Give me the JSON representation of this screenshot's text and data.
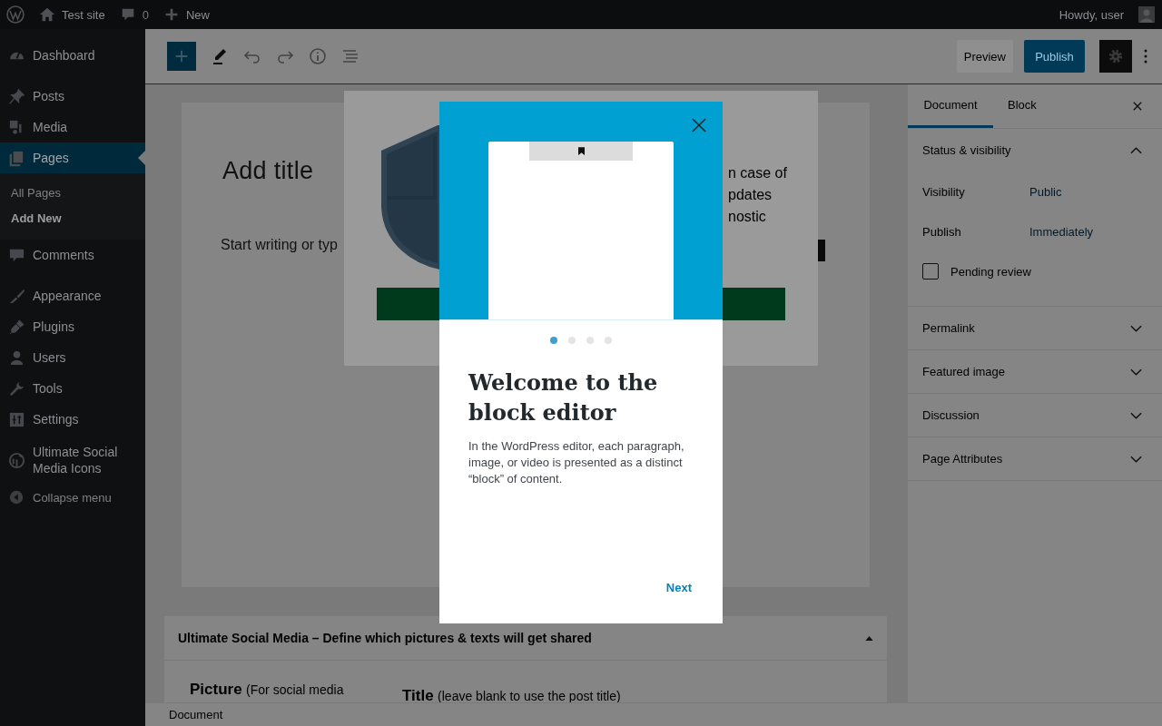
{
  "admin_bar": {
    "site": "Test site",
    "comments": "0",
    "new": "New",
    "greeting": "Howdy, user"
  },
  "sidebar": {
    "groups": [
      [
        {
          "label": "Dashboard",
          "selected": false
        }
      ],
      [
        {
          "label": "Posts",
          "selected": false
        },
        {
          "label": "Media",
          "selected": false
        },
        {
          "label": "Pages",
          "selected": true,
          "children": [
            {
              "label": "All Pages",
              "selected": false
            },
            {
              "label": "Add New",
              "selected": true
            }
          ]
        },
        {
          "label": "Comments",
          "selected": false
        }
      ],
      [
        {
          "label": "Appearance",
          "selected": false
        },
        {
          "label": "Plugins",
          "selected": false
        },
        {
          "label": "Users",
          "selected": false
        },
        {
          "label": "Tools",
          "selected": false
        },
        {
          "label": "Settings",
          "selected": false
        }
      ],
      [
        {
          "label": "Ultimate Social Media Icons",
          "selected": false
        }
      ]
    ],
    "collapse": "Collapse menu"
  },
  "toolbar": {
    "preview": "Preview",
    "publish": "Publish"
  },
  "editor": {
    "title_placeholder": "Add title",
    "body_placeholder": "Start writing or typ"
  },
  "background_popup": {
    "lines": [
      "n case of",
      "pdates",
      "nostic"
    ]
  },
  "modal": {
    "heading": "Welcome to the block editor",
    "body": "In the WordPress editor, each paragraph, image, or video is presented as a distinct “block” of content.",
    "pages": [
      {
        "selected": true
      },
      {
        "selected": false
      },
      {
        "selected": false
      },
      {
        "selected": false
      }
    ],
    "next": "Next"
  },
  "settings_panel": {
    "tabs": [
      {
        "label": "Document",
        "selected": true
      },
      {
        "label": "Block",
        "selected": false
      }
    ],
    "sections": [
      {
        "title": "Status & visibility",
        "expanded": true,
        "fields": [
          {
            "label": "Visibility",
            "value": "Public"
          },
          {
            "label": "Publish",
            "value": "Immediately"
          }
        ],
        "checkbox": {
          "label": "Pending review",
          "checked": false
        }
      },
      {
        "title": "Permalink",
        "expanded": false
      },
      {
        "title": "Featured image",
        "expanded": false
      },
      {
        "title": "Discussion",
        "expanded": false
      },
      {
        "title": "Page Attributes",
        "expanded": false
      }
    ]
  },
  "meta_box": {
    "title": "Ultimate Social Media – Define which pictures & texts will get shared",
    "picture_label": "Picture",
    "picture_hint": "(For social media",
    "title_label": "Title",
    "title_hint": "(leave blank to use the post title)"
  },
  "status_bar": "Document"
}
